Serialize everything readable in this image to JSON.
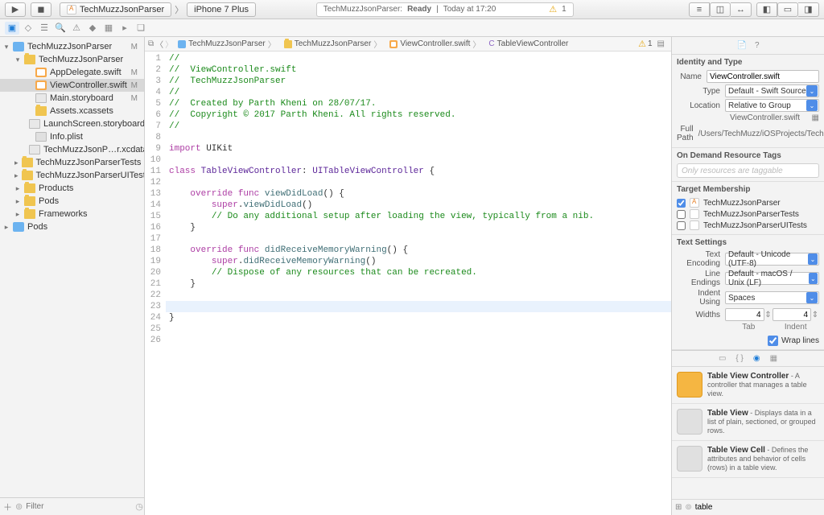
{
  "toolbar": {
    "scheme_target": "TechMuzzJsonParser",
    "scheme_device": "iPhone 7 Plus",
    "status_app": "TechMuzzJsonParser:",
    "status_state": "Ready",
    "status_time": "Today at 17:20",
    "warning_count": "1"
  },
  "navigator": {
    "items": [
      {
        "indent": 0,
        "disc": "▾",
        "icon": "proj",
        "label": "TechMuzzJsonParser",
        "badge": "M"
      },
      {
        "indent": 1,
        "disc": "▾",
        "icon": "folder",
        "label": "TechMuzzJsonParser",
        "badge": ""
      },
      {
        "indent": 2,
        "disc": "",
        "icon": "swift",
        "label": "AppDelegate.swift",
        "badge": "M"
      },
      {
        "indent": 2,
        "disc": "",
        "icon": "swift",
        "label": "ViewController.swift",
        "badge": "M",
        "selected": true
      },
      {
        "indent": 2,
        "disc": "",
        "icon": "story",
        "label": "Main.storyboard",
        "badge": "M"
      },
      {
        "indent": 2,
        "disc": "",
        "icon": "folder",
        "label": "Assets.xcassets",
        "badge": ""
      },
      {
        "indent": 2,
        "disc": "",
        "icon": "story",
        "label": "LaunchScreen.storyboard",
        "badge": ""
      },
      {
        "indent": 2,
        "disc": "",
        "icon": "gray",
        "label": "Info.plist",
        "badge": ""
      },
      {
        "indent": 2,
        "disc": "",
        "icon": "db",
        "label": "TechMuzzJsonP…r.xcdatamodeld",
        "badge": ""
      },
      {
        "indent": 1,
        "disc": "▸",
        "icon": "folder",
        "label": "TechMuzzJsonParserTests",
        "badge": ""
      },
      {
        "indent": 1,
        "disc": "▸",
        "icon": "folder",
        "label": "TechMuzzJsonParserUITests",
        "badge": ""
      },
      {
        "indent": 1,
        "disc": "▸",
        "icon": "folder",
        "label": "Products",
        "badge": ""
      },
      {
        "indent": 1,
        "disc": "▸",
        "icon": "folder",
        "label": "Pods",
        "badge": ""
      },
      {
        "indent": 1,
        "disc": "▸",
        "icon": "folder",
        "label": "Frameworks",
        "badge": ""
      },
      {
        "indent": 0,
        "disc": "▸",
        "icon": "proj",
        "label": "Pods",
        "badge": ""
      }
    ],
    "filter_placeholder": "Filter"
  },
  "jumpbar": {
    "segments": [
      "TechMuzzJsonParser",
      "TechMuzzJsonParser",
      "ViewController.swift",
      "TableViewController"
    ]
  },
  "code": {
    "lines": [
      {
        "n": 1,
        "html": "<span class='cm'>//</span>"
      },
      {
        "n": 2,
        "html": "<span class='cm'>//  ViewController.swift</span>"
      },
      {
        "n": 3,
        "html": "<span class='cm'>//  TechMuzzJsonParser</span>"
      },
      {
        "n": 4,
        "html": "<span class='cm'>//</span>"
      },
      {
        "n": 5,
        "html": "<span class='cm'>//  Created by Parth Kheni on 28/07/17.</span>"
      },
      {
        "n": 6,
        "html": "<span class='cm'>//  Copyright © 2017 Parth Kheni. All rights reserved.</span>"
      },
      {
        "n": 7,
        "html": "<span class='cm'>//</span>"
      },
      {
        "n": 8,
        "html": ""
      },
      {
        "n": 9,
        "html": "<span class='kw'>import</span> UIKit"
      },
      {
        "n": 10,
        "html": ""
      },
      {
        "n": 11,
        "html": "<span class='kw'>class</span> <span class='cls'>TableViewController</span>: <span class='cls'>UITableViewController</span> {"
      },
      {
        "n": 12,
        "html": ""
      },
      {
        "n": 13,
        "html": "    <span class='kw'>override</span> <span class='kw'>func</span> <span class='fn'>viewDidLoad</span>() {"
      },
      {
        "n": 14,
        "html": "        <span class='kw'>super</span>.<span class='fn'>viewDidLoad</span>()"
      },
      {
        "n": 15,
        "html": "        <span class='cm'>// Do any additional setup after loading the view, typically from a nib.</span>"
      },
      {
        "n": 16,
        "html": "    }"
      },
      {
        "n": 17,
        "html": ""
      },
      {
        "n": 18,
        "html": "    <span class='kw'>override</span> <span class='kw'>func</span> <span class='fn'>didReceiveMemoryWarning</span>() {"
      },
      {
        "n": 19,
        "html": "        <span class='kw'>super</span>.<span class='fn'>didReceiveMemoryWarning</span>()"
      },
      {
        "n": 20,
        "html": "        <span class='cm'>// Dispose of any resources that can be recreated.</span>"
      },
      {
        "n": 21,
        "html": "    }"
      },
      {
        "n": 22,
        "html": ""
      },
      {
        "n": 23,
        "html": "",
        "hl": true
      },
      {
        "n": 24,
        "html": "}"
      },
      {
        "n": 25,
        "html": ""
      },
      {
        "n": 26,
        "html": ""
      }
    ]
  },
  "inspector": {
    "identity_title": "Identity and Type",
    "name_lbl": "Name",
    "name_val": "ViewController.swift",
    "type_lbl": "Type",
    "type_val": "Default - Swift Source",
    "loc_lbl": "Location",
    "loc_val": "Relative to Group",
    "loc_path": "ViewController.swift",
    "fullpath_lbl": "Full Path",
    "fullpath_val": "/Users/TechMuzz/iOSProjects/TechMuzzJsonParser/TechMuzzJsonParser/ViewController.swift",
    "odr_title": "On Demand Resource Tags",
    "odr_placeholder": "Only resources are taggable",
    "tm_title": "Target Membership",
    "targets": [
      {
        "checked": true,
        "icon": "app",
        "label": "TechMuzzJsonParser"
      },
      {
        "checked": false,
        "icon": "test",
        "label": "TechMuzzJsonParserTests"
      },
      {
        "checked": false,
        "icon": "test",
        "label": "TechMuzzJsonParserUITests"
      }
    ],
    "ts_title": "Text Settings",
    "enc_lbl": "Text Encoding",
    "enc_val": "Default - Unicode (UTF-8)",
    "le_lbl": "Line Endings",
    "le_val": "Default - macOS / Unix (LF)",
    "iu_lbl": "Indent Using",
    "iu_val": "Spaces",
    "widths_lbl": "Widths",
    "tab_val": "4",
    "indent_val": "4",
    "tab_lbl": "Tab",
    "indent_lbl": "Indent",
    "wrap_lbl": "Wrap lines"
  },
  "library": {
    "items": [
      {
        "color": "yellow",
        "title": "Table View Controller",
        "desc": " - A controller that manages a table view."
      },
      {
        "color": "gray",
        "title": "Table View",
        "desc": " - Displays data in a list of plain, sectioned, or grouped rows."
      },
      {
        "color": "gray",
        "title": "Table View Cell",
        "desc": " - Defines the attributes and behavior of cells (rows) in a table view."
      }
    ],
    "filter_value": "table"
  }
}
